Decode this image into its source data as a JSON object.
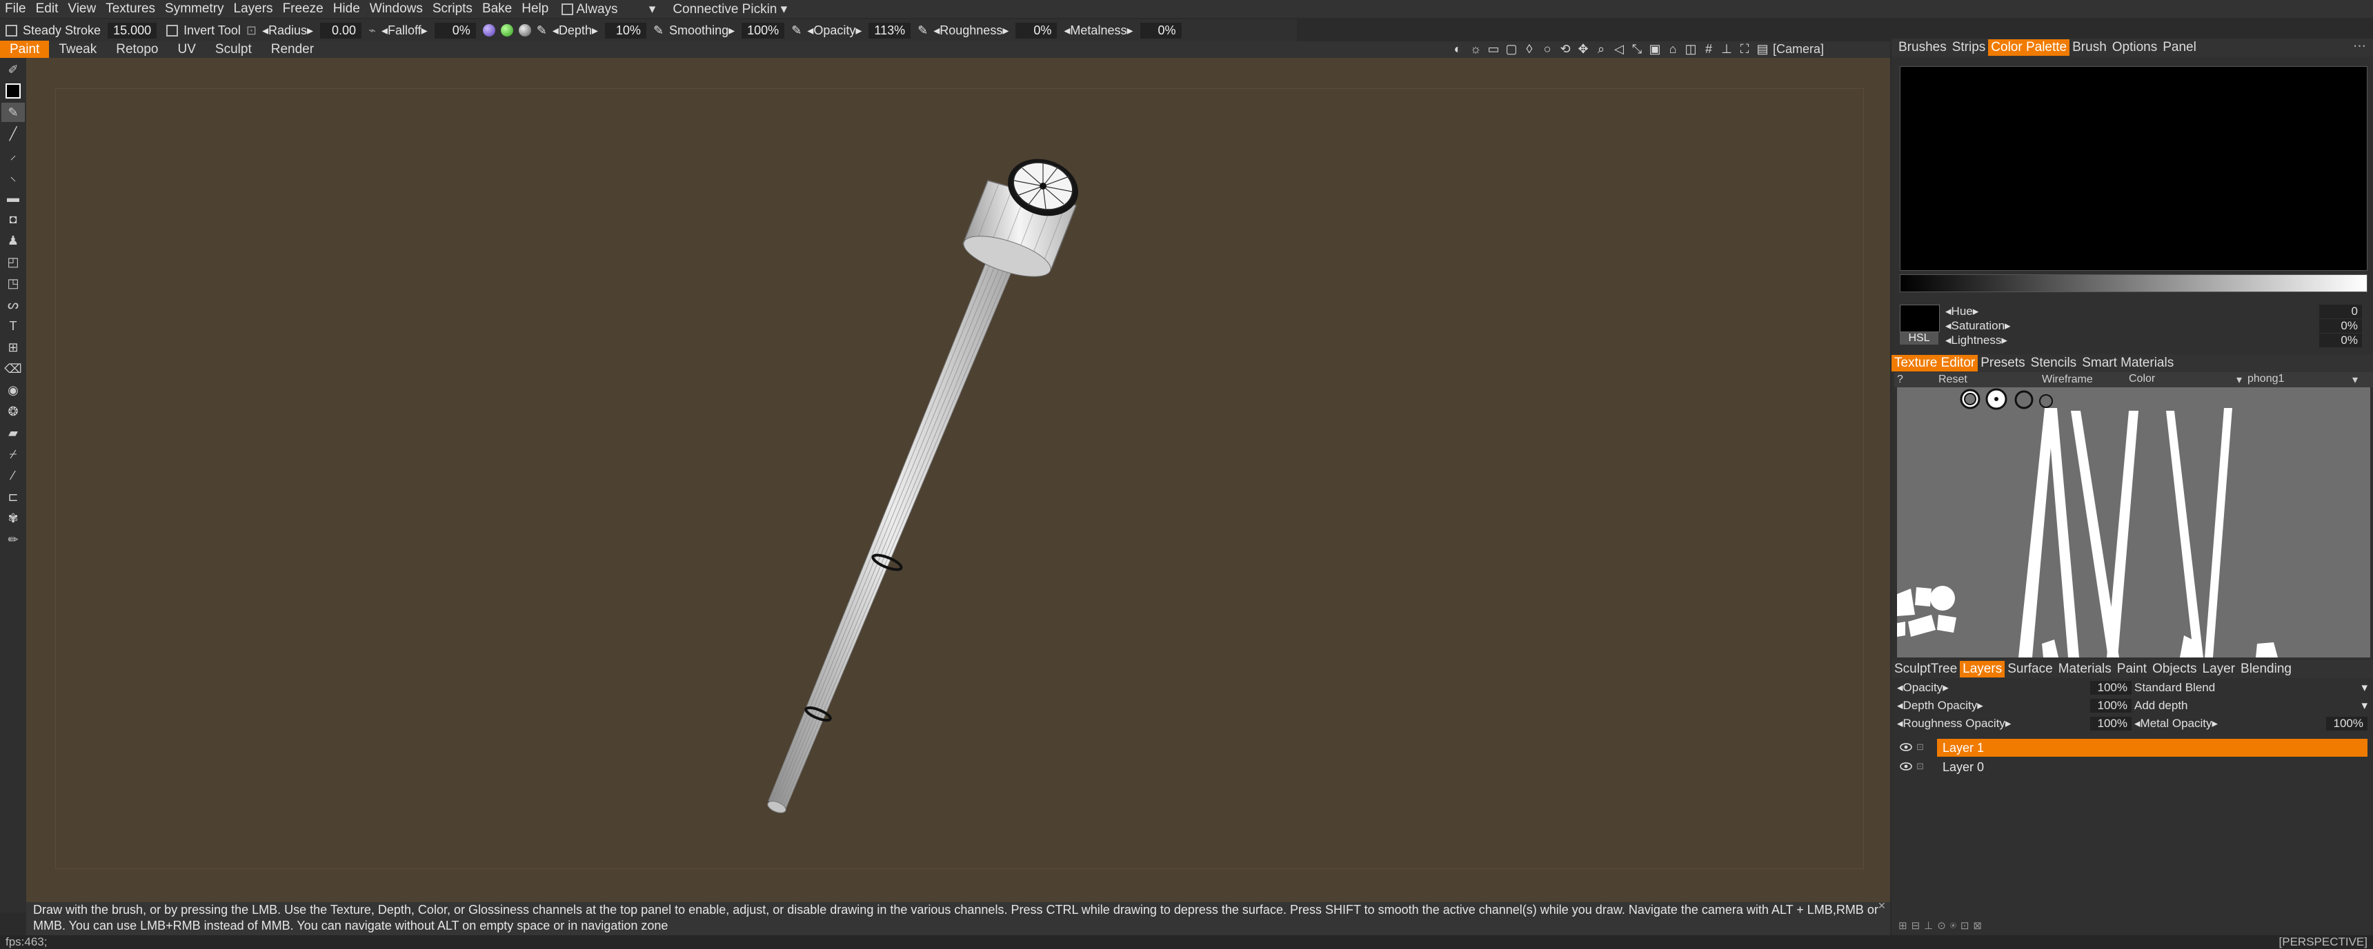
{
  "menubar": {
    "items": [
      "File",
      "Edit",
      "View",
      "Textures",
      "Symmetry",
      "Layers",
      "Freeze",
      "Hide",
      "Windows",
      "Scripts",
      "Bake",
      "Help"
    ],
    "always_label": "Always",
    "connective_label": "Connective",
    "pickin_label": "Pickin"
  },
  "toolbar": {
    "steady_stroke_label": "Steady Stroke",
    "steady_stroke_value": "15.000",
    "invert_tool_label": "Invert Tool",
    "radius_label": "Radius",
    "radius_value": "0.00",
    "falloff_label": "Falloff",
    "falloff_value": "0%",
    "depth_label": "Depth",
    "depth_value": "10%",
    "smoothing_label": "Smoothing",
    "smoothing_value": "100%",
    "opacity_label": "Opacity",
    "opacity_value": "113%",
    "roughness_label": "Roughness",
    "roughness_value": "0%",
    "metalness_label": "Metalness",
    "metalness_value": "0%"
  },
  "tabs": [
    "Paint",
    "Tweak",
    "Retopo",
    "UV",
    "Sculpt",
    "Render"
  ],
  "active_tab": "Paint",
  "camera_label": "[Camera]",
  "right_top_tabs": [
    "Brushes",
    "Strips",
    "Color Palette",
    "Brush",
    "Options",
    "Panel"
  ],
  "right_top_active": "Color Palette",
  "color": {
    "hsl_button": "HSL",
    "hue_label": "Hue",
    "hue_value": "0",
    "saturation_label": "Saturation",
    "saturation_value": "0%",
    "lightness_label": "Lightness",
    "lightness_value": "0%"
  },
  "texture_tabs": [
    "Texture Editor",
    "Presets",
    "Stencils",
    "Smart Materials"
  ],
  "texture_active": "Texture Editor",
  "texture_sub": {
    "q": "?",
    "reset": "Reset",
    "wireframe": "Wireframe",
    "channel": "Color",
    "material": "phong1"
  },
  "layer_tabs": [
    "SculptTree",
    "Layers",
    "Surface",
    "Materials",
    "Paint",
    "Objects",
    "Layer",
    "Blending"
  ],
  "layer_active": "Layers",
  "layer_props": {
    "opacity_label": "Opacity",
    "opacity_value": "100%",
    "blend_mode": "Standard Blend",
    "depth_opacity_label": "Depth Opacity",
    "depth_opacity_value": "100%",
    "depth_mode": "Add depth",
    "roughness_opacity_label": "Roughness Opacity",
    "roughness_opacity_value": "100%",
    "metal_opacity_label": "Metal Opacity",
    "metal_opacity_value": "100%"
  },
  "layers": [
    "Layer 1",
    "Layer 0"
  ],
  "active_layer": "Layer 1",
  "hint": "Draw with the brush, or by pressing the LMB. Use the Texture, Depth, Color, or Glossiness channels at the top panel to enable, adjust, or disable drawing in the various channels. Press CTRL while drawing to depress the surface. Press SHIFT to smooth the active channel(s) while you draw. Navigate the camera with ALT + LMB,RMB or MMB. You can use LMB+RMB instead of MMB. You can navigate without ALT on empty space or in navigation zone",
  "status": {
    "fps": "fps:463;",
    "view_mode": "[PERSPECTIVE]"
  },
  "colors": {
    "accent": "#f07b00",
    "viewport_bg": "#4d4131",
    "panel_bg": "#303030"
  }
}
